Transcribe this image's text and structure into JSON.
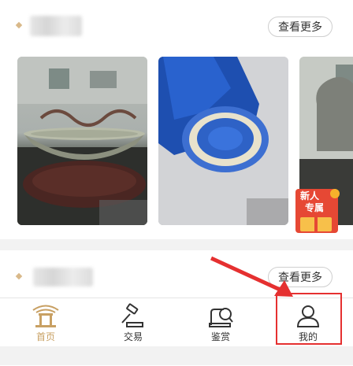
{
  "sections": [
    {
      "more_label": "查看更多"
    },
    {
      "more_label": "查看更多"
    }
  ],
  "badge": {
    "line1": "新人",
    "line2": "专属"
  },
  "tabs": [
    {
      "label": "首页",
      "icon": "pavilion-icon",
      "active": true
    },
    {
      "label": "交易",
      "icon": "gavel-icon",
      "active": false
    },
    {
      "label": "鉴赏",
      "icon": "appraise-magnifier-icon",
      "active": false
    },
    {
      "label": "我的",
      "icon": "user-icon",
      "active": false
    }
  ],
  "colors": {
    "accent": "#c8a063",
    "highlight_box": "#e53030",
    "arrow": "#e53030"
  }
}
